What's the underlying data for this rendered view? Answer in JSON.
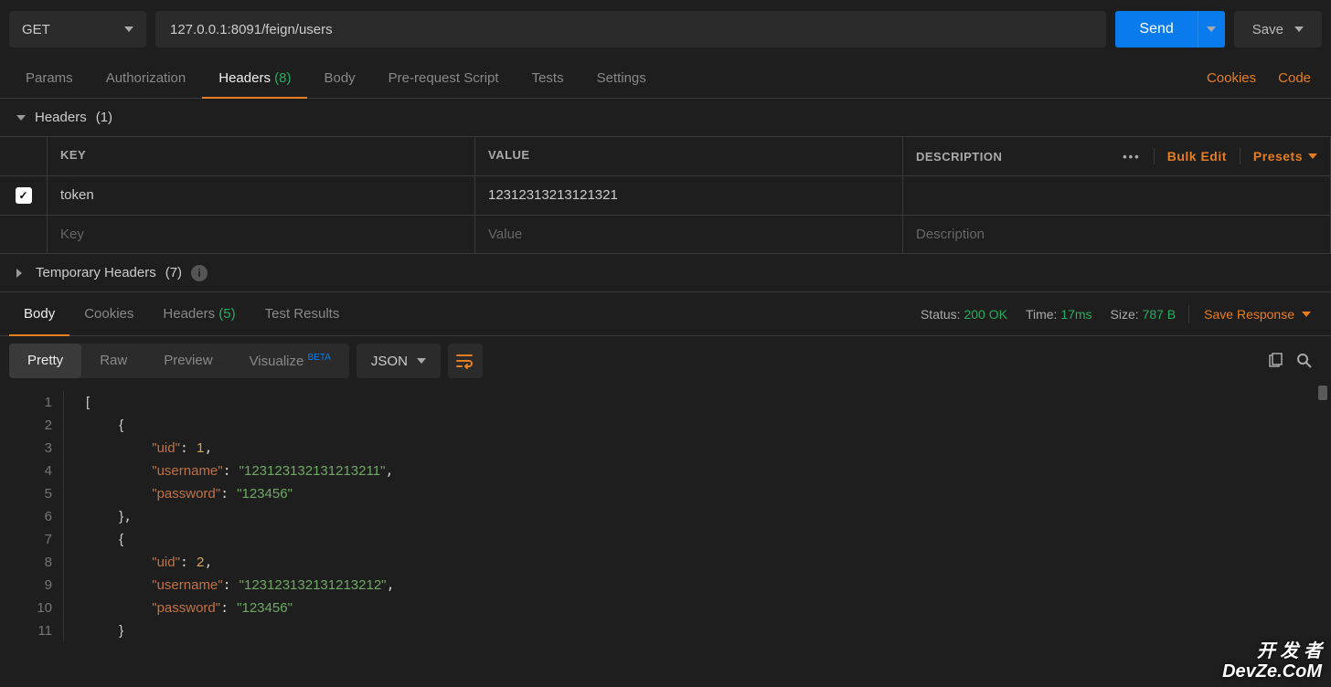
{
  "request": {
    "method": "GET",
    "url": "127.0.0.1:8091/feign/users",
    "send_label": "Send",
    "save_label": "Save"
  },
  "tabs": {
    "items": [
      {
        "label": "Params"
      },
      {
        "label": "Authorization"
      },
      {
        "label": "Headers",
        "count": "(8)",
        "active": true
      },
      {
        "label": "Body"
      },
      {
        "label": "Pre-request Script"
      },
      {
        "label": "Tests"
      },
      {
        "label": "Settings"
      }
    ],
    "cookies_link": "Cookies",
    "code_link": "Code"
  },
  "headers_panel": {
    "title": "Headers",
    "count": "(1)",
    "columns": {
      "key": "KEY",
      "value": "VALUE",
      "description": "DESCRIPTION"
    },
    "actions": {
      "bulk_edit": "Bulk Edit",
      "presets": "Presets"
    },
    "rows": [
      {
        "checked": true,
        "key": "token",
        "value": "12312313213121321",
        "description": ""
      }
    ],
    "placeholders": {
      "key": "Key",
      "value": "Value",
      "description": "Description"
    }
  },
  "temp_headers": {
    "label": "Temporary Headers",
    "count": "(7)"
  },
  "response_tabs": {
    "items": [
      {
        "label": "Body",
        "active": true
      },
      {
        "label": "Cookies"
      },
      {
        "label": "Headers",
        "count": "(5)"
      },
      {
        "label": "Test Results"
      }
    ],
    "status_label": "Status:",
    "status_value": "200 OK",
    "time_label": "Time:",
    "time_value": "17ms",
    "size_label": "Size:",
    "size_value": "787 B",
    "save_response": "Save Response"
  },
  "response_toolbar": {
    "views": [
      {
        "label": "Pretty",
        "active": true
      },
      {
        "label": "Raw"
      },
      {
        "label": "Preview"
      },
      {
        "label": "Visualize",
        "beta": "BETA"
      }
    ],
    "format": "JSON"
  },
  "code": {
    "lines": [
      "1",
      "2",
      "3",
      "4",
      "5",
      "6",
      "7",
      "8",
      "9",
      "10",
      "11"
    ],
    "body": [
      {
        "uid": 1,
        "username": "123123132131213211",
        "password": "123456"
      },
      {
        "uid": 2,
        "username": "123123132131213212",
        "password": "123456"
      }
    ]
  },
  "watermark": {
    "l1": "开 发 者",
    "l2": "DevZe.CoM"
  }
}
